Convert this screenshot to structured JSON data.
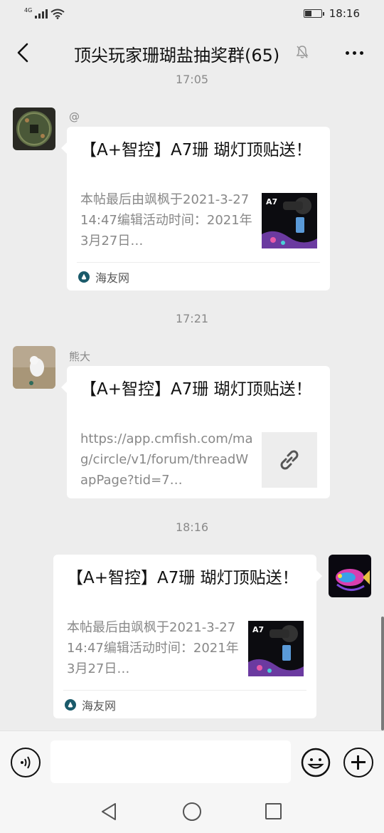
{
  "status_bar": {
    "network": "4G",
    "time": "18:16",
    "battery_level": 0.45
  },
  "header": {
    "title": "顶尖玩家珊瑚盐抽奖群(65)",
    "muted": true
  },
  "messages": [
    {
      "time_divider": "17:05",
      "sender": "@",
      "side": "left",
      "type": "article",
      "title": "【A+智控】A7珊 瑚灯顶贴送！",
      "description": "本帖最后由飒枫于2021-3-2714:47编辑活动时间：2021年3月27日…",
      "thumb_label": "A7",
      "source": "海友网"
    },
    {
      "time_divider": "17:21",
      "sender": "熊大",
      "side": "left",
      "type": "link",
      "title": "【A+智控】A7珊 瑚灯顶贴送！",
      "description": "https://app.cmfish.com/mag/circle/v1/forum/threadWapPage?tid=7…"
    },
    {
      "time_divider": "18:16",
      "side": "right",
      "type": "article",
      "title": "【A+智控】A7珊 瑚灯顶贴送！",
      "description": "本帖最后由飒枫于2021-3-2714:47编辑活动时间：2021年3月27日…",
      "thumb_label": "A7",
      "source": "海友网"
    }
  ],
  "input_bar": {
    "text_value": "",
    "icons": [
      "voice-icon",
      "emoji-icon",
      "plus-icon"
    ]
  },
  "system_nav": {
    "icons": [
      "nav-back-icon",
      "nav-home-icon",
      "nav-recent-icon"
    ]
  },
  "colors": {
    "background": "#ededed",
    "card": "#ffffff",
    "source_icon": "#1a5a6a"
  }
}
